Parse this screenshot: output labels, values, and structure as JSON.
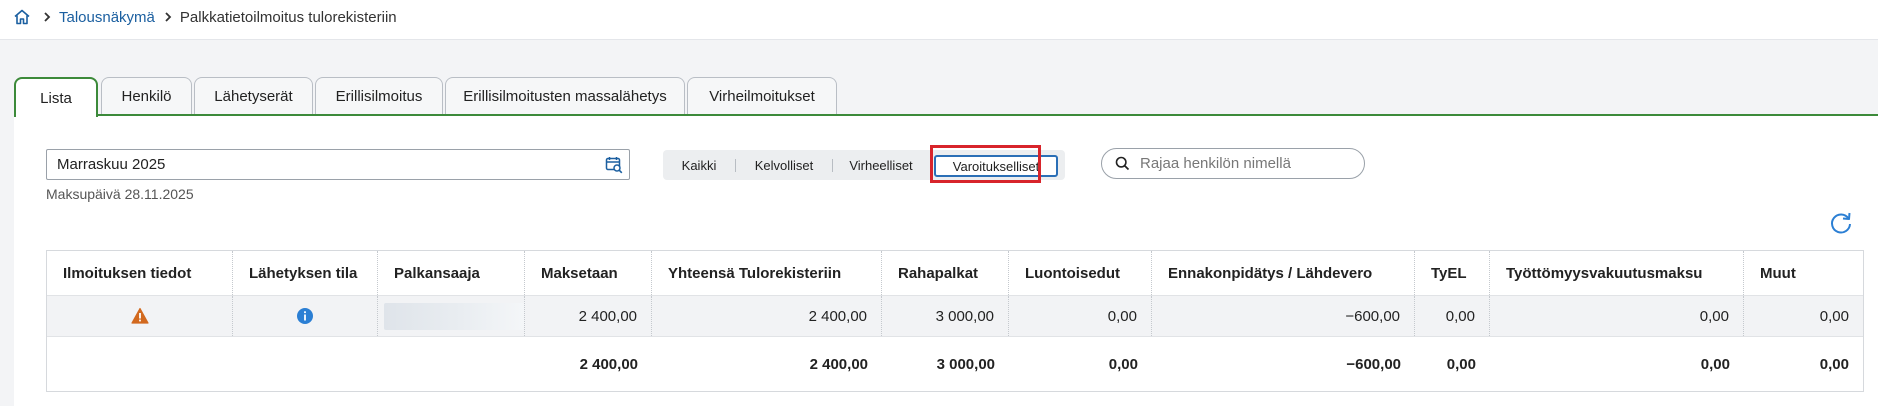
{
  "breadcrumb": {
    "home_icon": "home-icon",
    "parent": "Talousnäkymä",
    "current": "Palkkatietoilmoitus tulorekisteriin"
  },
  "tabs": [
    {
      "label": "Lista",
      "active": true
    },
    {
      "label": "Henkilö",
      "active": false
    },
    {
      "label": "Lähetyserät",
      "active": false
    },
    {
      "label": "Erillisilmoitus",
      "active": false
    },
    {
      "label": "Erillisilmoitusten massalähetys",
      "active": false
    },
    {
      "label": "Virheilmoitukset",
      "active": false
    }
  ],
  "period": {
    "value": "Marraskuu 2025",
    "payday": "Maksupäivä 28.11.2025",
    "icon": "calendar-search-icon"
  },
  "filters": {
    "items": [
      "Kaikki",
      "Kelvolliset",
      "Virheelliset",
      "Varoitukselliset"
    ],
    "selected": "Varoitukselliset"
  },
  "search": {
    "placeholder": "Rajaa henkilön nimellä",
    "value": ""
  },
  "table": {
    "headers": [
      "Ilmoituksen tiedot",
      "Lähetyksen tila",
      "Palkansaaja",
      "Maksetaan",
      "Yhteensä Tulorekisteriin",
      "Rahapalkat",
      "Luontoisedut",
      "Ennakonpidätys / Lähdevero",
      "TyEL",
      "Työttömyysvakuutusmaksu",
      "Muut"
    ],
    "rows": [
      {
        "notice_icon": "warning-icon",
        "status_icon": "info-icon",
        "payee": "",
        "maksetaan": "2 400,00",
        "yhteensa": "2 400,00",
        "rahapalkat": "3 000,00",
        "luontoisedut": "0,00",
        "ennakonpidatys": "−600,00",
        "tyel": "0,00",
        "tyottomyys": "0,00",
        "muut": "0,00"
      }
    ],
    "totals": {
      "maksetaan": "2 400,00",
      "yhteensa": "2 400,00",
      "rahapalkat": "3 000,00",
      "luontoisedut": "0,00",
      "ennakonpidatys": "−600,00",
      "tyel": "0,00",
      "tyottomyys": "0,00",
      "muut": "0,00"
    }
  },
  "colors": {
    "accent_green": "#3c8a3a",
    "link_blue": "#1b5fa0",
    "highlight_red": "#d8242b",
    "warning_orange": "#d2691e",
    "info_blue": "#2b7fd4"
  }
}
